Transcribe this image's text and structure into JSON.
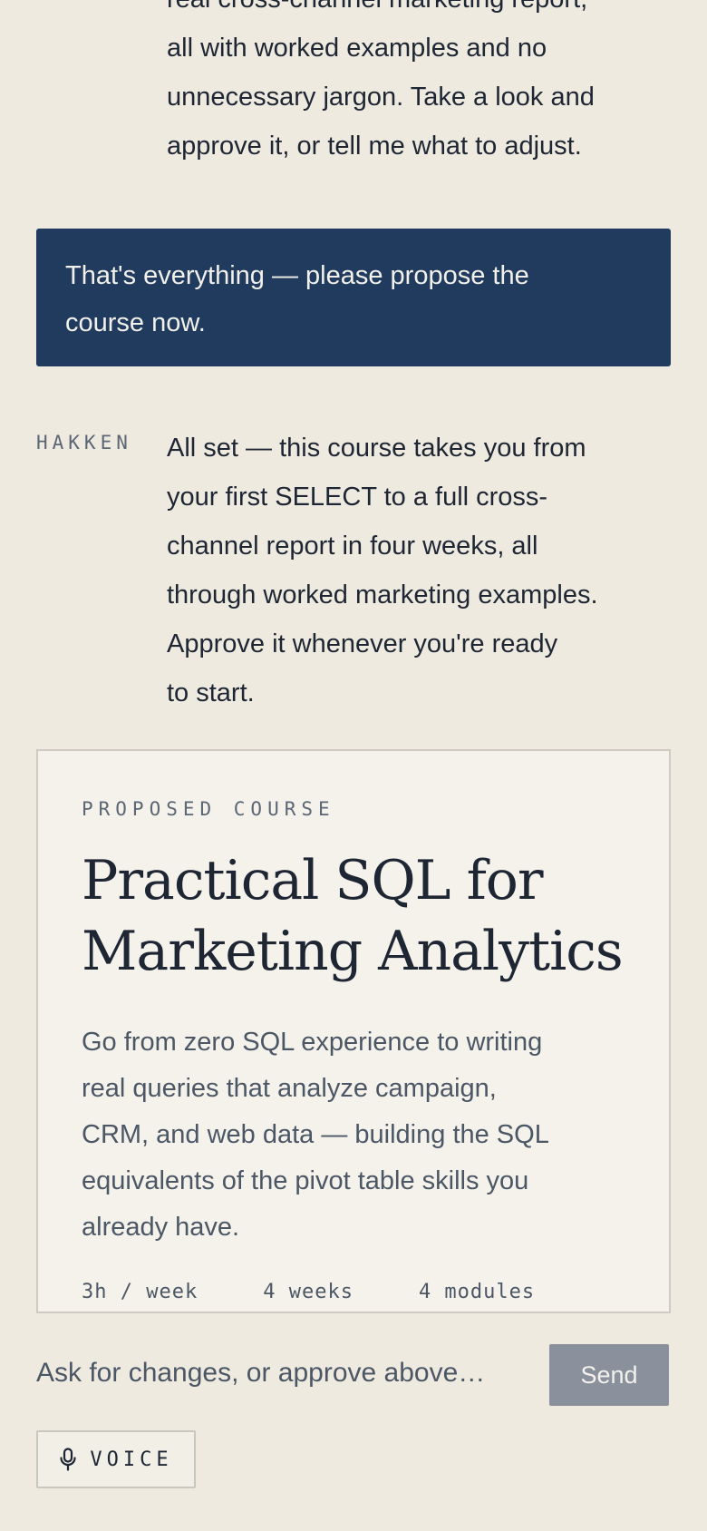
{
  "conversation": {
    "previous_agent_lines": [
      "real cross-channel marketing report,",
      "all with worked examples and no",
      "unnecessary jargon. Take a look and",
      "approve it, or tell me what to adjust."
    ],
    "user_message_lines": [
      "That's everything — please propose the",
      "course now."
    ],
    "agent_sender": "HAKKEN",
    "agent_message_lines": [
      "All set — this course takes you from",
      "your first SELECT to a full cross-",
      "channel report in four weeks, all",
      "through worked marketing examples.",
      "Approve it whenever you're ready",
      "to start."
    ]
  },
  "proposed_course": {
    "eyebrow": "PROPOSED COURSE",
    "title_lines": [
      "Practical SQL for",
      "Marketing Analytics"
    ],
    "description_lines": [
      "Go from zero SQL experience to writing",
      "real queries that analyze campaign,",
      "CRM, and web data — building the SQL",
      "equivalents of the pivot table skills you",
      "already have."
    ],
    "meta": {
      "hours": "3h / week",
      "duration": "4 weeks",
      "modules": "4 modules"
    }
  },
  "composer": {
    "placeholder": "Ask for changes, or approve above…",
    "send_label": "Send",
    "voice_label": "VOICE",
    "voice_icon": "microphone-icon"
  },
  "colors": {
    "background": "#eeeae0",
    "user_bubble": "#213b5f",
    "send_disabled": "#8a919c",
    "card_background": "#f4f2eb"
  }
}
